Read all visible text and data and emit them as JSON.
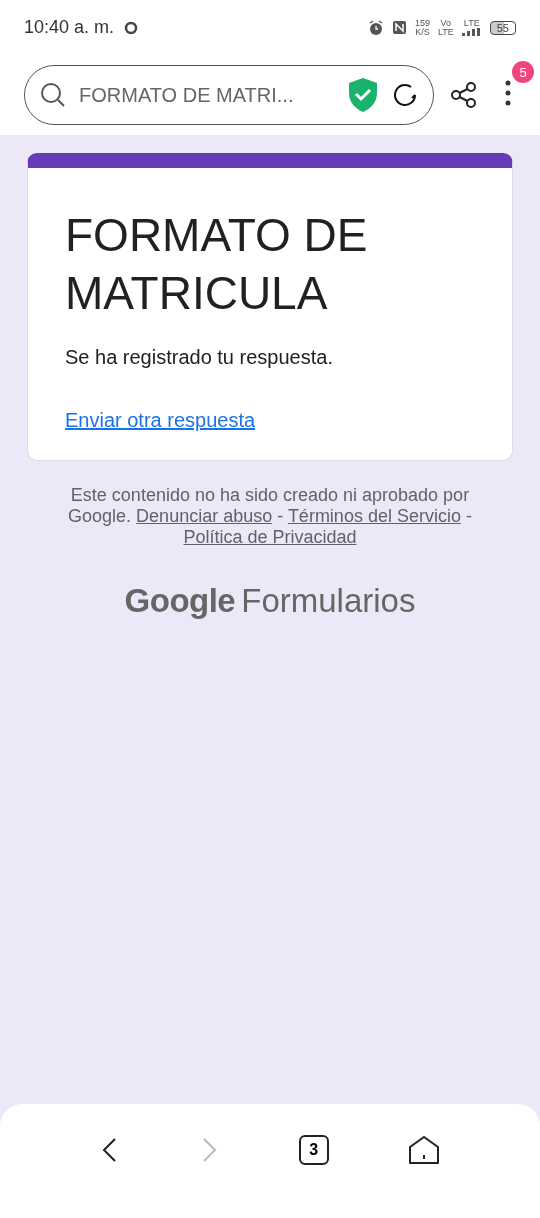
{
  "status_bar": {
    "time": "10:40 a. m.",
    "speed": "159",
    "speed_unit": "K/S",
    "volte_top": "Vo",
    "volte_bottom": "LTE",
    "network": "LTE",
    "battery": "55"
  },
  "browser_bar": {
    "address": "FORMATO DE MATRI...",
    "badge": "5"
  },
  "form": {
    "title": "FORMATO DE MATRICULA",
    "message": "Se ha registrado tu respuesta.",
    "link": "Enviar otra respuesta"
  },
  "footer": {
    "disclaimer": "Este contenido no ha sido creado ni aprobado por Google.",
    "links": [
      "Denunciar abuso",
      "Términos del Servicio",
      "Política de Privacidad"
    ],
    "separator": "-",
    "brand_google": "Google",
    "brand_product": "Formularios"
  },
  "nav": {
    "back_disabled": false,
    "forward_disabled": true,
    "tabs": "3"
  }
}
